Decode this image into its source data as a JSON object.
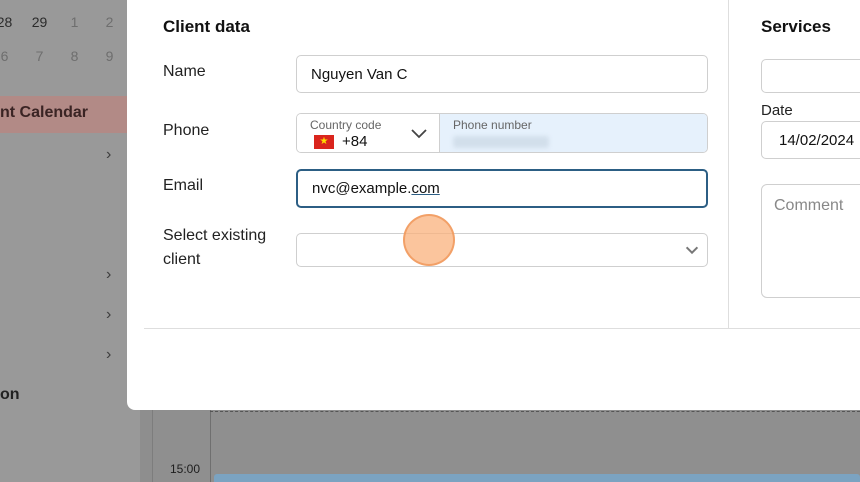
{
  "background": {
    "calendar_rows": [
      [
        "28",
        "29",
        "1",
        "2"
      ],
      [
        "6",
        "7",
        "8",
        "9"
      ]
    ],
    "active_item": "nt Calendar",
    "section_label": "on",
    "time_label": "15:00"
  },
  "modal": {
    "client_section": {
      "title": "Client data",
      "name_label": "Name",
      "name_value": "Nguyen Van C",
      "phone_label": "Phone",
      "country_code_label": "Country code",
      "country_code_value": "+84",
      "phone_number_label": "Phone number",
      "email_label": "Email",
      "email_local": "nvc@example.",
      "email_tld": "com",
      "select_label": "Select existing client",
      "select_value": ""
    },
    "services_section": {
      "title": "Services",
      "date_label": "Date",
      "date_value": "14/02/2024",
      "comment_placeholder": "Comment"
    }
  },
  "colors": {
    "focus_border": "#2c5e84",
    "phone_field_bg": "#e6f1fc",
    "cursor_highlight": "#fab17c"
  }
}
